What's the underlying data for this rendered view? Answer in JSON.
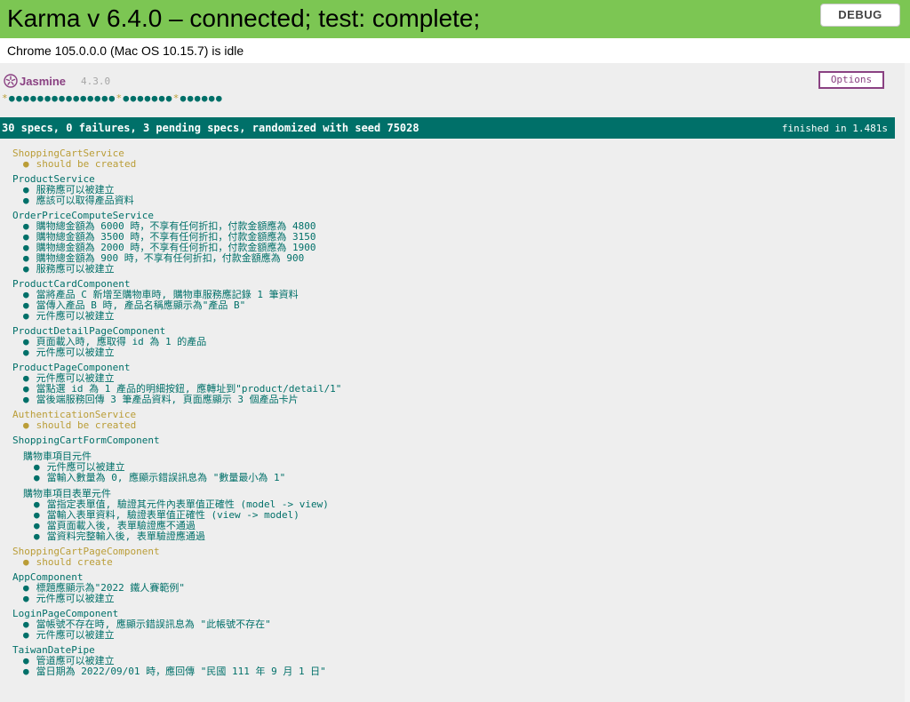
{
  "banner": {
    "title": "Karma v 6.4.0 – connected; test: complete;",
    "debug_label": "DEBUG"
  },
  "browser_status": "Chrome 105.0.0.0 (Mac OS 10.15.7) is idle",
  "jasmine": {
    "name": "Jasmine",
    "version": "4.3.0",
    "options_label": "Options",
    "dot_sequence": [
      "*",
      ".",
      ".",
      ".",
      ".",
      ".",
      ".",
      ".",
      ".",
      ".",
      ".",
      ".",
      ".",
      ".",
      ".",
      ".",
      "*",
      ".",
      ".",
      ".",
      ".",
      ".",
      ".",
      ".",
      "*",
      ".",
      ".",
      ".",
      ".",
      ".",
      "."
    ],
    "summary": "30 specs, 0 failures, 3 pending specs, randomized with seed 75028",
    "duration": "finished in 1.481s"
  },
  "colors": {
    "banner": "#7cc653",
    "passed": "#007069",
    "pending": "#ba9d37",
    "jasmine_purple": "#8a4182"
  },
  "suites": [
    {
      "name": "ShoppingCartService",
      "status": "pending",
      "specs": [
        {
          "label": "should be created",
          "status": "pending"
        }
      ]
    },
    {
      "name": "ProductService",
      "status": "passed",
      "specs": [
        {
          "label": "服務應可以被建立",
          "status": "passed"
        },
        {
          "label": "應該可以取得產品資料",
          "status": "passed"
        }
      ]
    },
    {
      "name": "OrderPriceComputeService",
      "status": "passed",
      "specs": [
        {
          "label": "購物總金額為 6000 時，不享有任何折扣，付款金額應為 4800",
          "status": "passed"
        },
        {
          "label": "購物總金額為 3500 時，不享有任何折扣，付款金額應為 3150",
          "status": "passed"
        },
        {
          "label": "購物總金額為 2000 時，不享有任何折扣，付款金額應為 1900",
          "status": "passed"
        },
        {
          "label": "購物總金額為 900 時，不享有任何折扣，付款金額應為 900",
          "status": "passed"
        },
        {
          "label": "服務應可以被建立",
          "status": "passed"
        }
      ]
    },
    {
      "name": "ProductCardComponent",
      "status": "passed",
      "specs": [
        {
          "label": "當將產品 C 新增至購物車時, 購物車服務應記錄 1 筆資料",
          "status": "passed"
        },
        {
          "label": "當傳入產品 B 時, 產品名稱應顯示為\"產品 B\"",
          "status": "passed"
        },
        {
          "label": "元件應可以被建立",
          "status": "passed"
        }
      ]
    },
    {
      "name": "ProductDetailPageComponent",
      "status": "passed",
      "specs": [
        {
          "label": "頁面載入時, 應取得 id 為 1 的產品",
          "status": "passed"
        },
        {
          "label": "元件應可以被建立",
          "status": "passed"
        }
      ]
    },
    {
      "name": "ProductPageComponent",
      "status": "passed",
      "specs": [
        {
          "label": "元件應可以被建立",
          "status": "passed"
        },
        {
          "label": "當點選 id 為 1 產品的明細按鈕, 應轉址到\"product/detail/1\"",
          "status": "passed"
        },
        {
          "label": "當後端服務回傳 3 筆產品資料, 頁面應顯示 3 個產品卡片",
          "status": "passed"
        }
      ]
    },
    {
      "name": "AuthenticationService",
      "status": "pending",
      "specs": [
        {
          "label": "should be created",
          "status": "pending"
        }
      ]
    },
    {
      "name": "ShoppingCartFormComponent",
      "status": "passed",
      "specs": [],
      "children": [
        {
          "name": "購物車項目元件",
          "status": "passed",
          "specs": [
            {
              "label": "元件應可以被建立",
              "status": "passed"
            },
            {
              "label": "當輸入數量為 0, 應顯示錯誤訊息為 \"數量最小為 1\"",
              "status": "passed"
            }
          ]
        },
        {
          "name": "購物車項目表單元件",
          "status": "passed",
          "specs": [
            {
              "label": "當指定表單值, 驗證其元件內表單值正確性 (model -> view)",
              "status": "passed"
            },
            {
              "label": "當輸入表單資料, 驗證表單值正確性 (view -> model)",
              "status": "passed"
            },
            {
              "label": "當頁面載入後, 表單驗證應不通過",
              "status": "passed"
            },
            {
              "label": "當資料完整輸入後, 表單驗證應通過",
              "status": "passed"
            }
          ]
        }
      ]
    },
    {
      "name": "ShoppingCartPageComponent",
      "status": "pending",
      "specs": [
        {
          "label": "should create",
          "status": "pending"
        }
      ]
    },
    {
      "name": "AppComponent",
      "status": "passed",
      "specs": [
        {
          "label": "標題應顯示為\"2022 鐵人賽範例\"",
          "status": "passed"
        },
        {
          "label": "元件應可以被建立",
          "status": "passed"
        }
      ]
    },
    {
      "name": "LoginPageComponent",
      "status": "passed",
      "specs": [
        {
          "label": "當帳號不存在時, 應顯示錯誤訊息為 \"此帳號不存在\"",
          "status": "passed"
        },
        {
          "label": "元件應可以被建立",
          "status": "passed"
        }
      ]
    },
    {
      "name": "TaiwanDatePipe",
      "status": "passed",
      "specs": [
        {
          "label": "管道應可以被建立",
          "status": "passed"
        },
        {
          "label": "當日期為 2022/09/01 時，應回傳 \"民國 111 年 9 月 1 日\"",
          "status": "passed"
        }
      ]
    }
  ]
}
